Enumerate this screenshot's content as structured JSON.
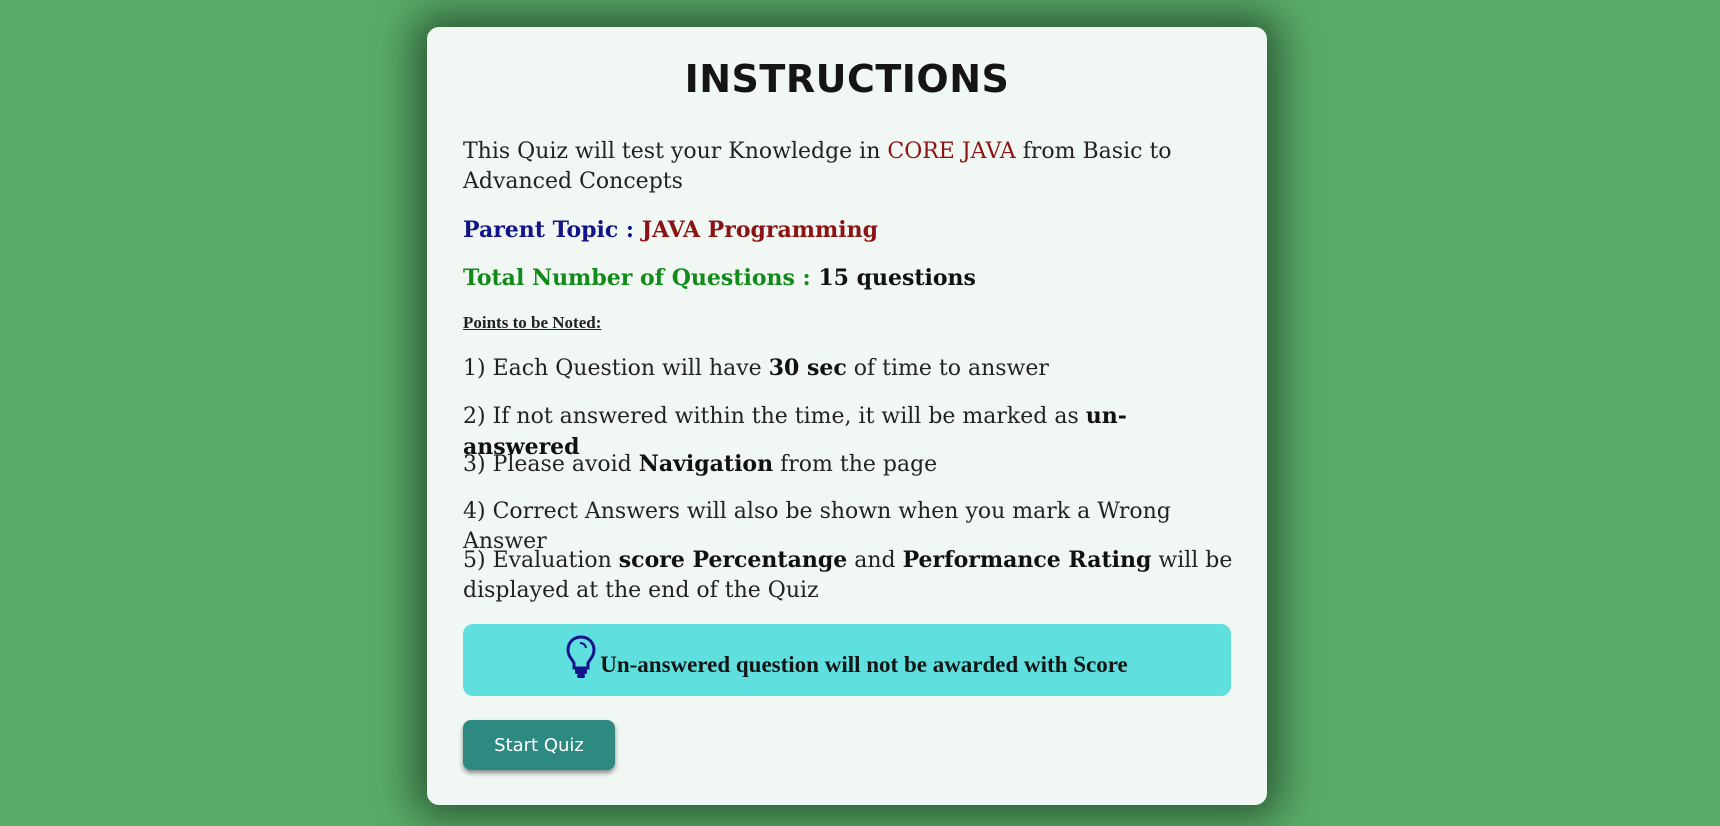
{
  "title": "INSTRUCTIONS",
  "intro": {
    "prefix": "This Quiz will test your Knowledge in ",
    "highlight": "CORE JAVA",
    "suffix": " from Basic to Advanced Concepts"
  },
  "parent_topic": {
    "label": "Parent Topic : ",
    "value": "JAVA Programming"
  },
  "total_questions": {
    "label": "Total Number of Questions : ",
    "value": "15 questions"
  },
  "points_heading": "Points to be Noted:",
  "points": {
    "p1": {
      "a": "1) Each Question will have ",
      "b": "30 sec",
      "c": " of time to answer"
    },
    "p2": {
      "a": "2) If not answered within the time, it will be marked as ",
      "b": "un-answered"
    },
    "p3": {
      "a": "3) Please avoid ",
      "b": "Navigation",
      "c": " from the page"
    },
    "p4": {
      "a": "4) Correct Answers will also be shown when you mark a Wrong Answer"
    },
    "p5": {
      "a": "5) Evaluation ",
      "b": "score Percentange",
      "c": " and ",
      "d": "Performance Rating",
      "e": " will be displayed at the end of the Quiz"
    }
  },
  "note": {
    "icon": "lightbulb-icon",
    "text": "Un-answered question will not be awarded with Score"
  },
  "start_button": "Start Quiz",
  "colors": {
    "background": "#5aab6a",
    "card": "#f1f7f3",
    "note_bg": "#5fe0df",
    "button": "#2e8a80",
    "dark_red": "#8b1313",
    "navy": "#13138b",
    "green": "#118a1a"
  }
}
